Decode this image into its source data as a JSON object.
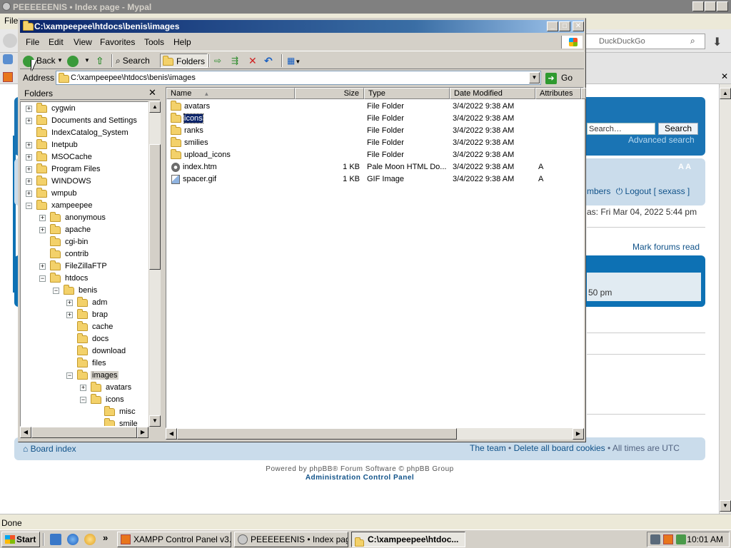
{
  "browser": {
    "title": "PEEEEEENIS • Index page - Mypal",
    "menu_file": "File",
    "search_engine": "DuckDuckGo",
    "status_text": "Done"
  },
  "forum": {
    "search_placeholder": "Search…",
    "search_button": "Search",
    "advanced_search": "Advanced search",
    "font_size": "A A",
    "members": "mbers",
    "logout": "Logout [ sexass ]",
    "last_visit": "as: Fri Mar 04, 2022 5:44 pm",
    "mark_read": "Mark forums read",
    "last_post_time": "50 pm",
    "board_index": "Board index",
    "the_team": "The team",
    "delete_cookies": "Delete all board cookies",
    "times_utc": "All times are UTC",
    "separator": "•",
    "powered_by": "Powered by phpBB® Forum Software © phpBB Group",
    "acp": "Administration Control Panel"
  },
  "explorer": {
    "title": "C:\\xampeepee\\htdocs\\benis\\images",
    "menu": [
      "File",
      "Edit",
      "View",
      "Favorites",
      "Tools",
      "Help"
    ],
    "toolbar": {
      "back": "Back",
      "search": "Search",
      "folders": "Folders"
    },
    "address_label": "Address",
    "address_value": "C:\\xampeepee\\htdocs\\benis\\images",
    "go": "Go",
    "folders_pane_title": "Folders",
    "tree": [
      {
        "label": "cygwin",
        "level": 0,
        "expander": "+"
      },
      {
        "label": "Documents and Settings",
        "level": 0,
        "expander": "+"
      },
      {
        "label": "IndexCatalog_System",
        "level": 0,
        "expander": ""
      },
      {
        "label": "Inetpub",
        "level": 0,
        "expander": "+"
      },
      {
        "label": "MSOCache",
        "level": 0,
        "expander": "+"
      },
      {
        "label": "Program Files",
        "level": 0,
        "expander": "+"
      },
      {
        "label": "WINDOWS",
        "level": 0,
        "expander": "+"
      },
      {
        "label": "wmpub",
        "level": 0,
        "expander": "+"
      },
      {
        "label": "xampeepee",
        "level": 0,
        "expander": "−"
      },
      {
        "label": "anonymous",
        "level": 1,
        "expander": "+"
      },
      {
        "label": "apache",
        "level": 1,
        "expander": "+"
      },
      {
        "label": "cgi-bin",
        "level": 1,
        "expander": ""
      },
      {
        "label": "contrib",
        "level": 1,
        "expander": ""
      },
      {
        "label": "FileZillaFTP",
        "level": 1,
        "expander": "+"
      },
      {
        "label": "htdocs",
        "level": 1,
        "expander": "−"
      },
      {
        "label": "benis",
        "level": 2,
        "expander": "−"
      },
      {
        "label": "adm",
        "level": 3,
        "expander": "+"
      },
      {
        "label": "brap",
        "level": 3,
        "expander": "+"
      },
      {
        "label": "cache",
        "level": 3,
        "expander": ""
      },
      {
        "label": "docs",
        "level": 3,
        "expander": ""
      },
      {
        "label": "download",
        "level": 3,
        "expander": ""
      },
      {
        "label": "files",
        "level": 3,
        "expander": ""
      },
      {
        "label": "images",
        "level": 3,
        "expander": "−",
        "selected": true
      },
      {
        "label": "avatars",
        "level": 4,
        "expander": "+"
      },
      {
        "label": "icons",
        "level": 4,
        "expander": "−"
      },
      {
        "label": "misc",
        "level": 5,
        "expander": ""
      },
      {
        "label": "smile",
        "level": 5,
        "expander": ""
      }
    ],
    "columns": {
      "name": "Name",
      "size": "Size",
      "type": "Type",
      "modified": "Date Modified",
      "attributes": "Attributes"
    },
    "files": [
      {
        "name": "avatars",
        "size": "",
        "type": "File Folder",
        "modified": "3/4/2022 9:38 AM",
        "attributes": "",
        "icon": "folder-icon"
      },
      {
        "name": "icons",
        "size": "",
        "type": "File Folder",
        "modified": "3/4/2022 9:38 AM",
        "attributes": "",
        "icon": "folder-icon",
        "selected": true
      },
      {
        "name": "ranks",
        "size": "",
        "type": "File Folder",
        "modified": "3/4/2022 9:38 AM",
        "attributes": "",
        "icon": "folder-icon"
      },
      {
        "name": "smilies",
        "size": "",
        "type": "File Folder",
        "modified": "3/4/2022 9:38 AM",
        "attributes": "",
        "icon": "folder-icon"
      },
      {
        "name": "upload_icons",
        "size": "",
        "type": "File Folder",
        "modified": "3/4/2022 9:38 AM",
        "attributes": "",
        "icon": "folder-icon"
      },
      {
        "name": "index.htm",
        "size": "1 KB",
        "type": "Pale Moon HTML Do...",
        "modified": "3/4/2022 9:38 AM",
        "attributes": "A",
        "icon": "html-file-icon"
      },
      {
        "name": "spacer.gif",
        "size": "1 KB",
        "type": "GIF Image",
        "modified": "3/4/2022 9:38 AM",
        "attributes": "A",
        "icon": "gif-file-icon"
      }
    ]
  },
  "taskbar": {
    "start": "Start",
    "chevron": "»",
    "tasks": [
      {
        "label": "XAMPP Control Panel v3....",
        "active": false
      },
      {
        "label": "PEEEEEENIS • Index pag...",
        "active": false
      },
      {
        "label": "C:\\xampeepee\\htdoc...",
        "active": true
      }
    ],
    "clock": "10:01 AM"
  },
  "colors": {
    "title_active": "#0a246a",
    "forum_blue": "#0b6ca8",
    "forum_link": "#105289",
    "selection": "#0a246a"
  }
}
